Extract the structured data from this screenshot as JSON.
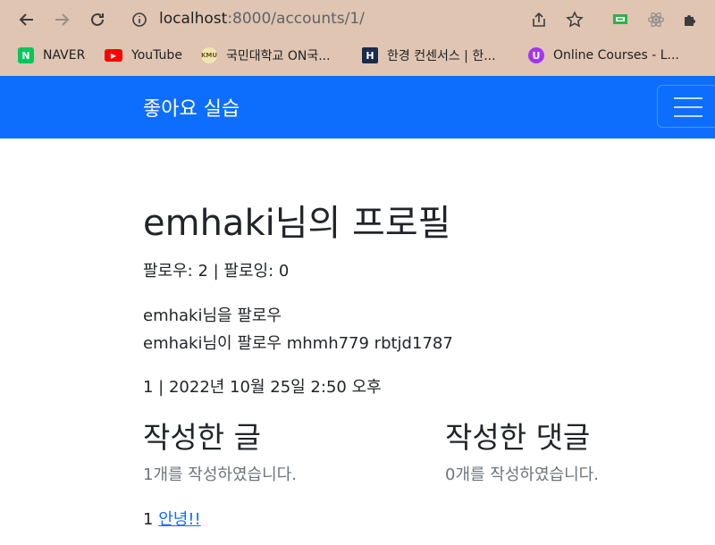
{
  "browser": {
    "url_host": "localhost",
    "url_path": ":8000/accounts/1/",
    "bookmarks": [
      {
        "label": "NAVER",
        "icon": "naver-icon",
        "color": "#03c75a"
      },
      {
        "label": "YouTube",
        "icon": "youtube-icon",
        "color": "#ff0000"
      },
      {
        "label": "국민대학교 ON국...",
        "icon": "kmu-icon",
        "color": "#c9b458"
      },
      {
        "label": "한경 컨센서스 | 한...",
        "icon": "hankyung-icon",
        "color": "#1a2b4c"
      },
      {
        "label": "Online Courses - L...",
        "icon": "udemy-icon",
        "color": "#a435f0"
      }
    ]
  },
  "navbar": {
    "brand": "좋아요 실습",
    "accent": "#0d6efd"
  },
  "profile": {
    "title": "emhaki님의 프로필",
    "follow_counts": "팔로우: 2 | 팔로잉: 0",
    "follow_button_text": "emhaki님을 팔로우",
    "followers_line": "emhaki님이 팔로우 mhmh779 rbtjd1787",
    "info_line": "1 | 2022년 10월 25일 2:50 오후"
  },
  "articles": {
    "heading": "작성한 글",
    "count_text": "1개를 작성하였습니다.",
    "items": [
      {
        "id": "1",
        "title": "안녕!!"
      }
    ]
  },
  "comments": {
    "heading": "작성한 댓글",
    "count_text": "0개를 작성하였습니다."
  }
}
